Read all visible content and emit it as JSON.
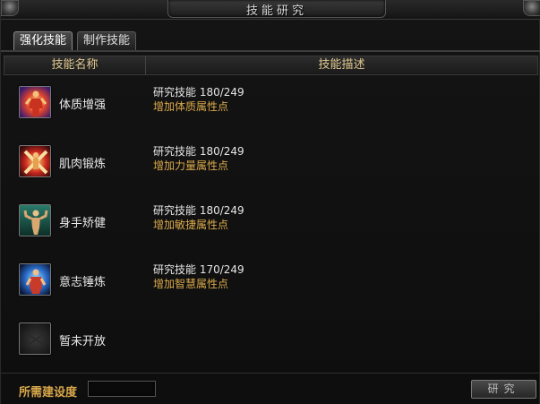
{
  "window": {
    "title": "技能研究"
  },
  "tabs": [
    {
      "label": "强化技能",
      "active": true
    },
    {
      "label": "制作技能",
      "active": false
    }
  ],
  "table": {
    "headers": {
      "name": "技能名称",
      "desc": "技能描述"
    },
    "rows": [
      {
        "icon": "strength-body-icon",
        "name": "体质增强",
        "research": "研究技能 180/249",
        "effect": "增加体质属性点"
      },
      {
        "icon": "crossed-swords-icon",
        "name": "肌肉锻炼",
        "research": "研究技能 180/249",
        "effect": "增加力量属性点"
      },
      {
        "icon": "flexing-figure-icon",
        "name": "身手矫健",
        "research": "研究技能 180/249",
        "effect": "增加敏捷属性点"
      },
      {
        "icon": "meditating-figure-icon",
        "name": "意志锤炼",
        "research": "研究技能 170/249",
        "effect": "增加智慧属性点"
      },
      {
        "icon": "locked-slot-icon",
        "name": "暂未开放",
        "research": "",
        "effect": ""
      }
    ]
  },
  "footer": {
    "requirement_label": "所需建设度",
    "requirement_value": "",
    "research_button": "研究"
  },
  "colors": {
    "gold": "#d9a84a",
    "header_text": "#e0c890"
  }
}
